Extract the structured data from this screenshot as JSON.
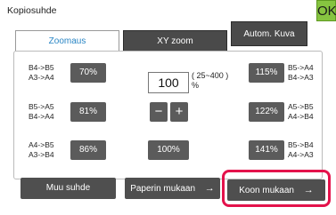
{
  "window": {
    "title": "Kopiosuhde",
    "ok_label": "OK"
  },
  "tabs": [
    {
      "label": "Zoomaus",
      "active": true
    },
    {
      "label": "XY zoom",
      "active": false
    },
    {
      "label": "Autom. Kuva",
      "active": false
    }
  ],
  "presets": {
    "left": [
      {
        "ratio_line1": "B4->B5",
        "ratio_line2": "A3->A4",
        "value": "70%"
      },
      {
        "ratio_line1": "B5->A5",
        "ratio_line2": "B4->A4",
        "value": "81%"
      },
      {
        "ratio_line1": "A4->B5",
        "ratio_line2": "A3->B4",
        "value": "86%"
      }
    ],
    "right": [
      {
        "value": "115%",
        "ratio_line1": "B5->A4",
        "ratio_line2": "B4->A3"
      },
      {
        "value": "122%",
        "ratio_line1": "A5->B5",
        "ratio_line2": "A4->B4"
      },
      {
        "value": "141%",
        "ratio_line1": "B5->B4",
        "ratio_line2": "A4->A3"
      }
    ],
    "center": {
      "value": "100%"
    }
  },
  "zoom": {
    "current_value": "100",
    "range_line1": "( 25~400 )",
    "range_line2": "%",
    "minus_label": "−",
    "plus_label": "+"
  },
  "bottom_buttons": [
    {
      "label": "Muu suhde",
      "arrow": ""
    },
    {
      "label": "Paperin mukaan",
      "arrow": "→"
    },
    {
      "label": "Koon mukaan",
      "arrow": "→",
      "highlighted": true
    }
  ],
  "colors": {
    "ok_green": "#86c440",
    "active_tab_text": "#2a86c5",
    "button_dark": "#5b5b5b",
    "highlight_red": "#e4124b"
  }
}
